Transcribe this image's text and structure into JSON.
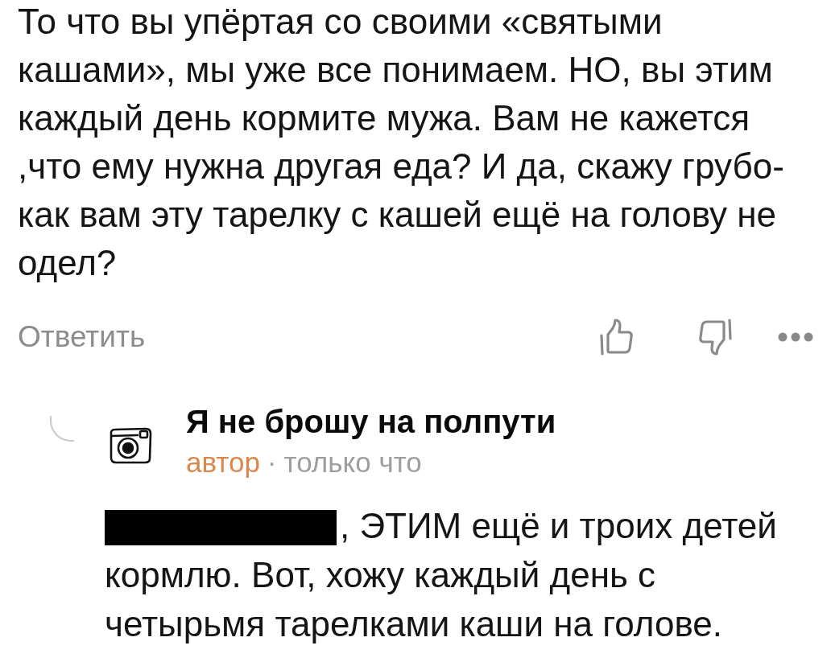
{
  "comment": {
    "text": "То что вы упёртая со своими «святыми кашами», мы уже все понимаем. НО, вы этим каждый день кормите мужа. Вам не кажется ,что ему нужна другая еда? И да, скажу грубо- как вам эту тарелку с кашей ещё на голову не одел?",
    "reply_link": "Ответить",
    "actions": [
      {
        "kind": "like"
      },
      {
        "kind": "dislike"
      },
      {
        "kind": "more"
      }
    ]
  },
  "reply": {
    "author": "Я не брошу на полпути",
    "badge": "автор",
    "separator": "·",
    "time": "только что",
    "redacted": true,
    "text": ", ЭТИМ ещё и троих детей кормлю. Вот, хожу каждый день с четырьмя тарелками каши на голове."
  }
}
